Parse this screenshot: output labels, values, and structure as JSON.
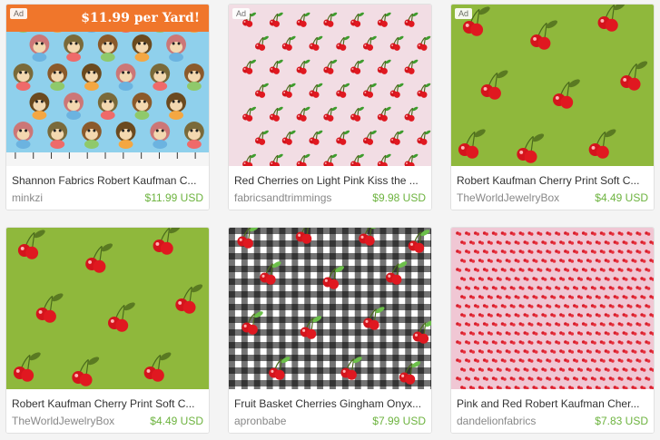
{
  "listings": [
    {
      "title": "Shannon Fabrics Robert Kaufman C...",
      "shop": "minkzi",
      "price": "$11.99 USD",
      "ad": "Ad",
      "promo": "$11.99 per Yard!",
      "image": "monkey-fabric"
    },
    {
      "title": "Red Cherries on Light Pink Kiss the ...",
      "shop": "fabricsandtrimmings",
      "price": "$9.98 USD",
      "ad": "Ad",
      "image": "cherries-pink-fabric"
    },
    {
      "title": "Robert Kaufman Cherry Print Soft C...",
      "shop": "TheWorldJewelryBox",
      "price": "$4.49 USD",
      "ad": "Ad",
      "image": "cherries-green-fabric"
    },
    {
      "title": "Robert Kaufman Cherry Print Soft C...",
      "shop": "TheWorldJewelryBox",
      "price": "$4.49 USD",
      "image": "cherries-green-fabric"
    },
    {
      "title": "Fruit Basket Cherries Gingham Onyx...",
      "shop": "apronbabe",
      "price": "$7.99 USD",
      "image": "cherries-gingham-fabric"
    },
    {
      "title": "Pink and Red Robert Kaufman Cher...",
      "shop": "dandelionfabrics",
      "price": "$7.83 USD",
      "image": "tiny-cherries-pink-fabric"
    }
  ],
  "colors": {
    "price_green": "#6db33f",
    "promo_orange": "#f0762b"
  }
}
